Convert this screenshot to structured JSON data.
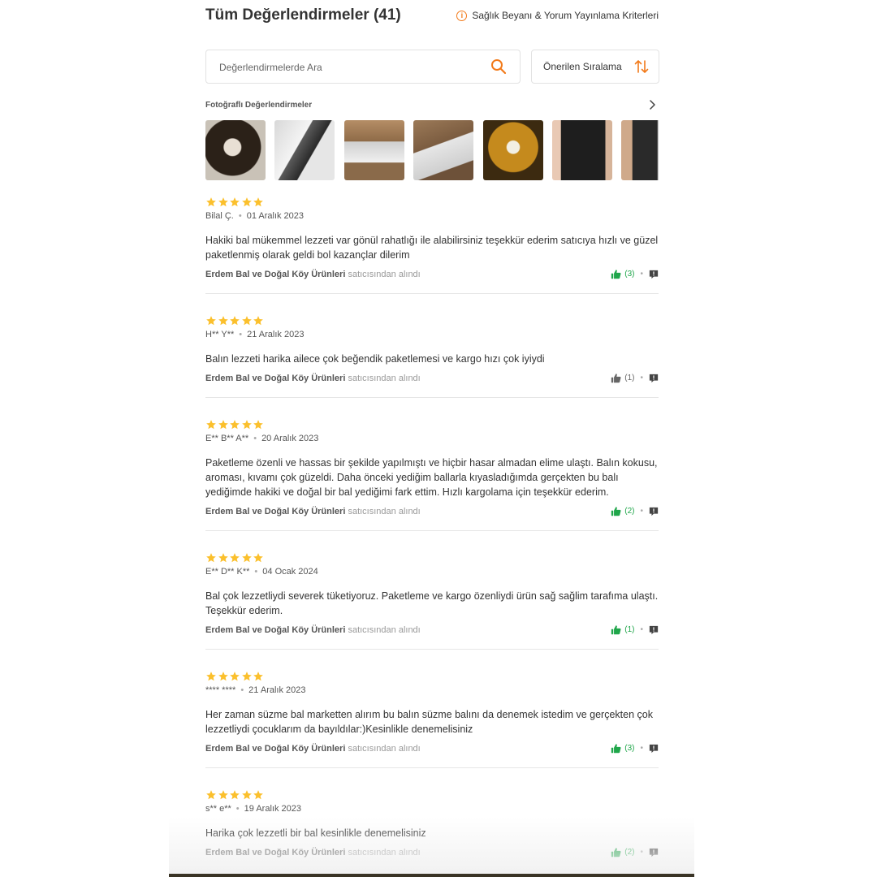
{
  "header": {
    "title": "Tüm Değerlendirmeler (41)",
    "criteria_link": "Sağlık Beyanı & Yorum Yayınlama Kriterleri"
  },
  "search": {
    "placeholder": "Değerlendirmelerde Ara"
  },
  "sort": {
    "label": "Önerilen Sıralama"
  },
  "photos": {
    "label": "Fotoğraflı Değerlendirmeler",
    "count": 7
  },
  "colors": {
    "accent": "#f27a1a",
    "star": "#fbc02d",
    "like_active": "#1fa64a",
    "like_inactive": "#666666"
  },
  "reviews": [
    {
      "rating": 5,
      "author": "Bilal Ç.",
      "date": "01 Aralık 2023",
      "text": "Hakiki bal mükemmel lezzeti var gönül rahatlığı ile alabilirsiniz teşekkür ederim satıcıya hızlı ve güzel paketlenmiş olarak geldi bol kazançlar dilerim",
      "seller": "Erdem Bal ve Doğal Köy Ürünleri",
      "seller_suffix": "satıcısından alındı",
      "likes": "(3)",
      "liked": true
    },
    {
      "rating": 5,
      "author": "H** Y**",
      "date": "21 Aralık 2023",
      "text": "Balın lezzeti harika ailece çok beğendik paketlemesi ve kargo hızı çok iyiydi",
      "seller": "Erdem Bal ve Doğal Köy Ürünleri",
      "seller_suffix": "satıcısından alındı",
      "likes": "(1)",
      "liked": false
    },
    {
      "rating": 5,
      "author": "E** B** A**",
      "date": "20 Aralık 2023",
      "text": "Paketleme özenli ve hassas bir şekilde yapılmıştı ve hiçbir hasar almadan elime ulaştı. Balın kokusu, aroması, kıvamı çok güzeldi. Daha önceki yediğim ballarla kıyasladığımda gerçekten bu balı yediğimde hakiki ve doğal bir bal yediğimi fark ettim. Hızlı kargolama için teşekkür ederim.",
      "seller": "Erdem Bal ve Doğal Köy Ürünleri",
      "seller_suffix": "satıcısından alındı",
      "likes": "(2)",
      "liked": true
    },
    {
      "rating": 5,
      "author": "E** D** K**",
      "date": "04 Ocak 2024",
      "text": "Bal çok lezzetliydi severek tüketiyoruz. Paketleme ve kargo özenliydi ürün sağ sağlim tarafıma ulaştı. Teşekkür ederim.",
      "seller": "Erdem Bal ve Doğal Köy Ürünleri",
      "seller_suffix": "satıcısından alındı",
      "likes": "(1)",
      "liked": true
    },
    {
      "rating": 5,
      "author": "**** ****",
      "date": "21 Aralık 2023",
      "text": "Her zaman süzme bal marketten alırım bu balın süzme balını da denemek istedim ve gerçekten çok lezzetliydi çocuklarım da bayıldılar:)Kesinlikle denemelisiniz",
      "seller": "Erdem Bal ve Doğal Köy Ürünleri",
      "seller_suffix": "satıcısından alındı",
      "likes": "(3)",
      "liked": true
    },
    {
      "rating": 5,
      "author": "s** e**",
      "date": "19 Aralık 2023",
      "text": "Harika çok lezzetli bir bal kesinlikle denemelisiniz",
      "seller": "Erdem Bal ve Doğal Köy Ürünleri",
      "seller_suffix": "satıcısından alındı",
      "likes": "(2)",
      "liked": true
    }
  ]
}
